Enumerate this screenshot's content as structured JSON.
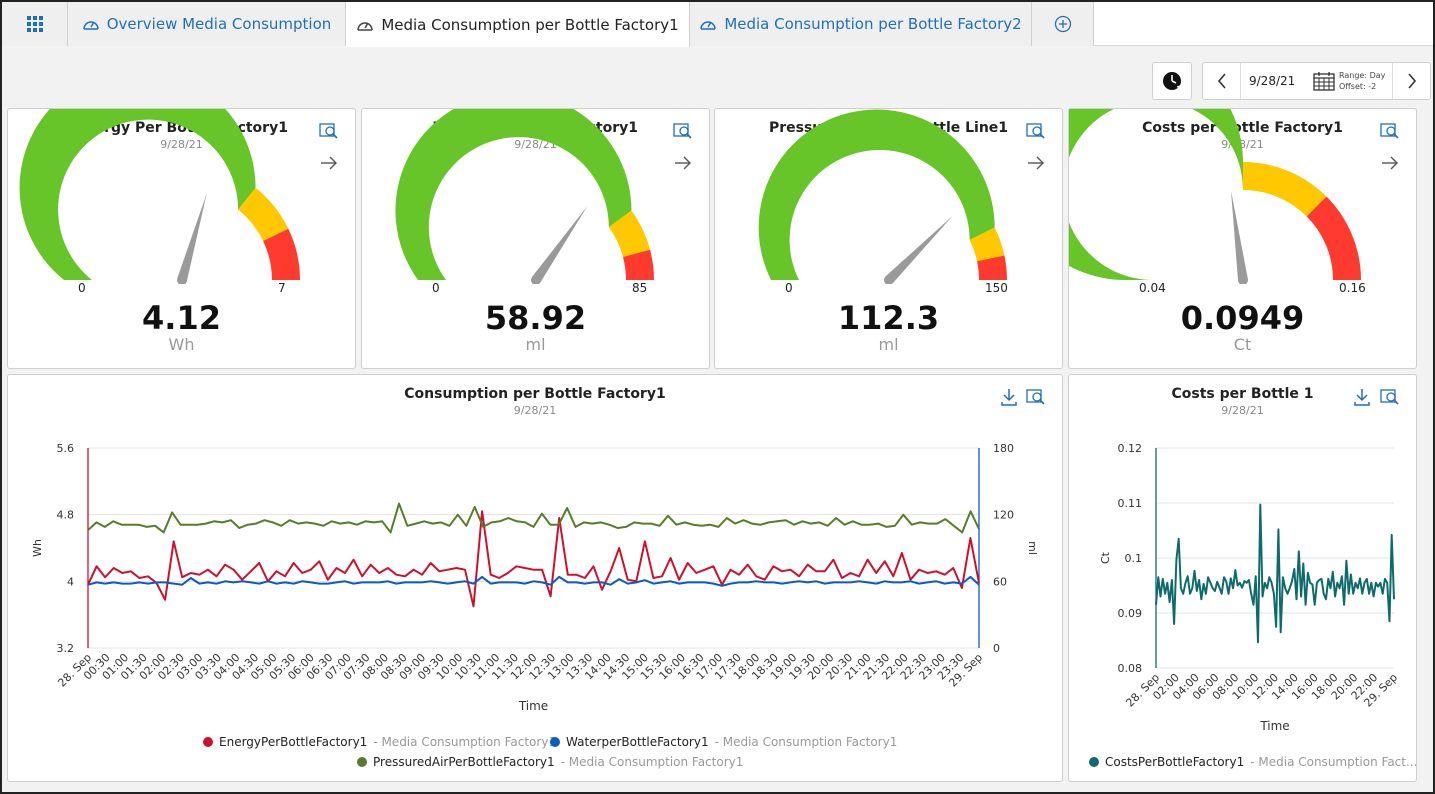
{
  "tabs": [
    {
      "label": "Overview Media Consumption",
      "active": false
    },
    {
      "label": "Media Consumption per Bottle Factory1",
      "active": true
    },
    {
      "label": "Media Consumption per Bottle Factory2",
      "active": false
    }
  ],
  "toolbar": {
    "date": "9/28/21",
    "range": "Range: Day",
    "offset": "Offset: -2"
  },
  "gauges": [
    {
      "title": "Energy Per Bottle Factory1",
      "date": "9/28/21",
      "min_label": "0",
      "max_label": "7",
      "value_label": "4.12",
      "unit": "Wh",
      "min": 0,
      "max": 7,
      "value": 4.12,
      "bands": [
        {
          "to": 5.0,
          "color": "#67c52a"
        },
        {
          "to": 6.0,
          "color": "#ffc800"
        },
        {
          "to": 7,
          "color": "#ff3a2f"
        }
      ]
    },
    {
      "title": "Water per Bottle Factory1",
      "date": "9/28/21",
      "min_label": "0",
      "max_label": "85",
      "value_label": "58.92",
      "unit": "ml",
      "min": 0,
      "max": 85,
      "value": 58.92,
      "bands": [
        {
          "to": 68,
          "color": "#67c52a"
        },
        {
          "to": 78,
          "color": "#ffc800"
        },
        {
          "to": 85,
          "color": "#ff3a2f"
        }
      ]
    },
    {
      "title": "Pressured Air per Bottle Line1",
      "date": "9/28/21",
      "min_label": "0",
      "max_label": "150",
      "value_label": "112.3",
      "unit": "ml",
      "min": 0,
      "max": 150,
      "value": 112.3,
      "bands": [
        {
          "to": 128,
          "color": "#67c52a"
        },
        {
          "to": 140,
          "color": "#ffc800"
        },
        {
          "to": 150,
          "color": "#ff3a2f"
        }
      ]
    },
    {
      "title": "Costs per Bottle Factory1",
      "date": "9/28/21",
      "min_label": "0.04",
      "max_label": "0.16",
      "value_label": "0.0949",
      "unit": "Ct",
      "min": 0.04,
      "max": 0.16,
      "value": 0.0949,
      "bands": [
        {
          "to": 0.1,
          "color": "#67c52a"
        },
        {
          "to": 0.13,
          "color": "#ffc800"
        },
        {
          "to": 0.16,
          "color": "#ff3a2f"
        }
      ]
    }
  ],
  "consumption_chart": {
    "title": "Consumption per Bottle Factory1",
    "date": "9/28/21"
  },
  "costs_chart": {
    "title": "Costs per Bottle 1",
    "date": "9/28/21"
  },
  "legend": {
    "energy": "EnergyPerBottleFactory1",
    "water": "WaterperBottleFactory1",
    "air": "PressuredAirPerBottleFactory1",
    "costs": "CostsPerBottleFactory1",
    "source": " - Media Consumption Factory1",
    "source_short": " - Media Consumption Fact..."
  },
  "colors": {
    "energy": "#d0102b",
    "water": "#0a5cc2",
    "air": "#5a7b2a",
    "costs": "#0f6b6b",
    "link": "#1f6fc0"
  },
  "chart_data": [
    {
      "type": "line",
      "title": "Consumption per Bottle Factory1",
      "xlabel": "Time",
      "ylabel": "Wh",
      "y2label": "ml",
      "ylim": [
        3.2,
        5.6
      ],
      "y2lim": [
        0,
        180
      ],
      "yticks": [
        "5.6",
        "4.8",
        "4",
        "3.2"
      ],
      "y2ticks": [
        "180",
        "120",
        "60",
        "0"
      ],
      "xticks": [
        "28. Sep",
        "00:30",
        "01:00",
        "01:30",
        "02:00",
        "02:30",
        "03:00",
        "03:30",
        "04:00",
        "04:30",
        "05:00",
        "05:30",
        "06:00",
        "06:30",
        "07:00",
        "07:30",
        "08:00",
        "08:30",
        "09:00",
        "09:30",
        "10:00",
        "10:30",
        "11:00",
        "11:30",
        "12:00",
        "12:30",
        "13:00",
        "13:30",
        "14:00",
        "14:30",
        "15:00",
        "15:30",
        "16:00",
        "16:30",
        "17:00",
        "17:30",
        "18:00",
        "18:30",
        "19:00",
        "19:30",
        "20:00",
        "20:30",
        "21:00",
        "21:30",
        "22:00",
        "22:30",
        "23:00",
        "23:30",
        "29. Sep"
      ],
      "legend_position": "bottom",
      "series": [
        {
          "name": "EnergyPerBottleFactory1",
          "axis": "left",
          "values": [
            3.96,
            4.18,
            4.05,
            4.16,
            4.1,
            4.12,
            4.04,
            4.06,
            3.98,
            3.78,
            4.48,
            4.05,
            4.1,
            4.08,
            4.14,
            4.06,
            4.2,
            4.14,
            4.02,
            4.12,
            4.22,
            4.0,
            4.12,
            4.06,
            4.22,
            4.1,
            4.14,
            4.24,
            4.02,
            4.16,
            4.1,
            4.26,
            4.06,
            4.2,
            4.1,
            4.16,
            4.08,
            4.06,
            4.14,
            4.08,
            4.22,
            4.12,
            4.14,
            4.16,
            4.14,
            3.7,
            4.84,
            4.08,
            4.04,
            4.1,
            4.18,
            4.16,
            4.14,
            4.14,
            3.82,
            4.76,
            4.08,
            4.08,
            4.04,
            4.18,
            3.9,
            4.12,
            4.4,
            4.02,
            4.0,
            4.48,
            4.04,
            4.06,
            4.28,
            4.02,
            4.22,
            4.1,
            4.14,
            4.18,
            3.96,
            4.14,
            4.08,
            4.2,
            4.06,
            4.02,
            4.18,
            4.12,
            4.14,
            4.06,
            4.2,
            4.12,
            4.12,
            4.26,
            4.04,
            4.1,
            4.06,
            4.26,
            4.1,
            4.24,
            4.06,
            4.34,
            4.02,
            4.14,
            4.1,
            4.12,
            4.08,
            4.16,
            3.92,
            4.52,
            3.98
          ]
        },
        {
          "name": "WaterperBottleFactory1",
          "axis": "right",
          "values": [
            57,
            59,
            58,
            59,
            58,
            58,
            59,
            58,
            59,
            59,
            58,
            57,
            63,
            58,
            59,
            58,
            60,
            59,
            60,
            59,
            58,
            60,
            58,
            59,
            58,
            60,
            59,
            58,
            58,
            59,
            60,
            58,
            59,
            59,
            59,
            60,
            58,
            59,
            59,
            59,
            60,
            59,
            58,
            59,
            60,
            58,
            64,
            58,
            59,
            59,
            59,
            58,
            60,
            59,
            57,
            64,
            59,
            59,
            58,
            59,
            59,
            57,
            62,
            58,
            59,
            61,
            58,
            59,
            60,
            58,
            59,
            59,
            59,
            58,
            56,
            58,
            59,
            59,
            60,
            59,
            59,
            58,
            59,
            60,
            59,
            60,
            58,
            59,
            59,
            59,
            60,
            59,
            58,
            60,
            59,
            59,
            60,
            58,
            59,
            60,
            58,
            59,
            58,
            64,
            57
          ]
        },
        {
          "name": "PressuredAirPerBottleFactory1",
          "axis": "right",
          "values": [
            106,
            113,
            109,
            114,
            111,
            111,
            111,
            109,
            110,
            104,
            122,
            111,
            111,
            111,
            112,
            114,
            113,
            115,
            108,
            111,
            112,
            115,
            113,
            110,
            115,
            112,
            113,
            112,
            110,
            114,
            112,
            113,
            111,
            114,
            113,
            114,
            104,
            130,
            110,
            112,
            114,
            112,
            113,
            110,
            120,
            110,
            127,
            109,
            113,
            114,
            117,
            114,
            113,
            109,
            121,
            111,
            111,
            126,
            109,
            113,
            112,
            113,
            111,
            108,
            109,
            113,
            112,
            112,
            110,
            119,
            111,
            113,
            111,
            110,
            111,
            109,
            117,
            112,
            115,
            112,
            111,
            113,
            114,
            115,
            111,
            114,
            112,
            113,
            110,
            117,
            111,
            114,
            111,
            111,
            112,
            109,
            110,
            120,
            111,
            113,
            112,
            112,
            116,
            110,
            104,
            123,
            107
          ]
        }
      ]
    },
    {
      "type": "line",
      "title": "Costs per Bottle 1",
      "xlabel": "Time",
      "ylabel": "Ct",
      "ylim": [
        0.08,
        0.12
      ],
      "yticks": [
        "0.12",
        "0.11",
        "0.1",
        "0.09",
        "0.08"
      ],
      "xticks": [
        "28. Sep",
        "02:00",
        "04:00",
        "06:00",
        "08:00",
        "10:00",
        "12:00",
        "14:00",
        "16:00",
        "18:00",
        "20:00",
        "22:00",
        "29. Sep"
      ],
      "legend_position": "bottom",
      "series": [
        {
          "name": "CostsPerBottleFactory1",
          "values": [
            0.0915,
            0.0965,
            0.093,
            0.0962,
            0.0935,
            0.0955,
            0.092,
            0.096,
            0.088,
            0.0997,
            0.1035,
            0.0945,
            0.0935,
            0.0955,
            0.0967,
            0.0935,
            0.0945,
            0.0977,
            0.094,
            0.096,
            0.0925,
            0.0953,
            0.0935,
            0.0965,
            0.0955,
            0.0945,
            0.094,
            0.0957,
            0.0946,
            0.0935,
            0.0965,
            0.0957,
            0.0935,
            0.0963,
            0.0945,
            0.0978,
            0.095,
            0.0955,
            0.0946,
            0.0958,
            0.0955,
            0.096,
            0.0935,
            0.0915,
            0.0967,
            0.0847,
            0.1097,
            0.093,
            0.0955,
            0.0945,
            0.0965,
            0.0955,
            0.0935,
            0.0875,
            0.1052,
            0.0865,
            0.0965,
            0.0945,
            0.0935,
            0.0945,
            0.0958,
            0.098,
            0.0925,
            0.1012,
            0.093,
            0.099,
            0.0915,
            0.0973,
            0.0955,
            0.0952,
            0.0915,
            0.0955,
            0.096,
            0.0962,
            0.0935,
            0.0925,
            0.0962,
            0.0945,
            0.0975,
            0.093,
            0.0955,
            0.0945,
            0.0967,
            0.0915,
            0.0995,
            0.0935,
            0.097,
            0.0935,
            0.0955,
            0.0945,
            0.0963,
            0.0935,
            0.0955,
            0.0962,
            0.0935,
            0.0955,
            0.093,
            0.0955,
            0.0948,
            0.0955,
            0.0935,
            0.0962,
            0.0955,
            0.0885,
            0.1042,
            0.0925
          ]
        }
      ]
    }
  ]
}
